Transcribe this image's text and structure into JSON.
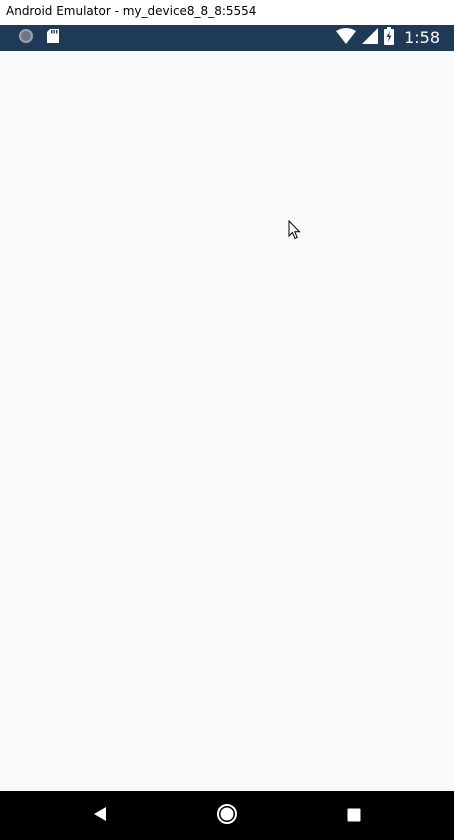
{
  "window": {
    "title": "Android Emulator - my_device8_8_8:5554"
  },
  "status_bar": {
    "time": "1:58",
    "left_icons": [
      "notification-circle-icon",
      "sd-card-icon"
    ],
    "right_icons": [
      "wifi-icon",
      "cell-signal-icon",
      "battery-charging-icon"
    ],
    "background": "#1f3a57"
  },
  "content": {
    "background": "#fafafa"
  },
  "nav_bar": {
    "buttons": [
      "back-icon",
      "home-icon",
      "recents-icon"
    ],
    "background": "#000000"
  }
}
